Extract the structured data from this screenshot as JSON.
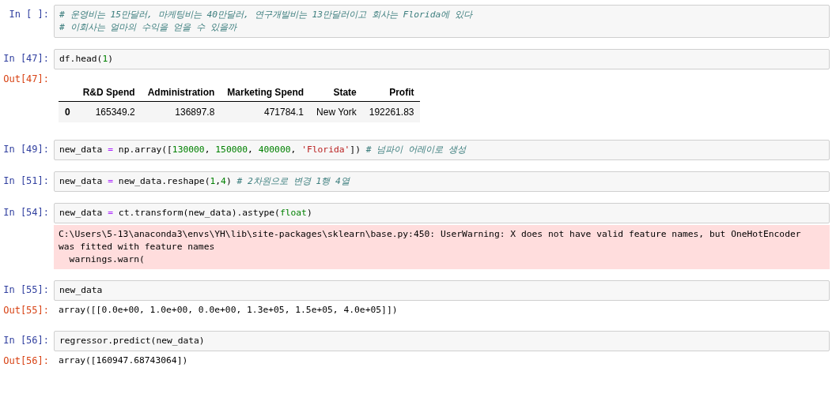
{
  "cells": [
    {
      "prompt": "In [ ]:",
      "lines": [
        [
          {
            "kind": "comment",
            "text": "# 운영비는 15만달러, 마케팅비는 40만달러, 연구개발비는 13만달러이고 회사는 Florida에 있다"
          }
        ],
        [
          {
            "kind": "comment",
            "text": "# 이회사는 얼마의 수익을 얻을 수 있을까"
          }
        ]
      ]
    },
    {
      "prompt": "In [47]:",
      "lines": [
        [
          {
            "kind": "plain",
            "text": "df.head("
          },
          {
            "kind": "num",
            "text": "1"
          },
          {
            "kind": "plain",
            "text": ")"
          }
        ]
      ],
      "output": {
        "kind": "table",
        "prompt": "Out[47]:",
        "columns": [
          "",
          "R&D Spend",
          "Administration",
          "Marketing Spend",
          "State",
          "Profit"
        ],
        "rows": [
          [
            "0",
            "165349.2",
            "136897.8",
            "471784.1",
            "New York",
            "192261.83"
          ]
        ]
      }
    },
    {
      "prompt": "In [49]:",
      "lines": [
        [
          {
            "kind": "plain",
            "text": "new_data "
          },
          {
            "kind": "op",
            "text": "="
          },
          {
            "kind": "plain",
            "text": " np.array(["
          },
          {
            "kind": "num",
            "text": "130000"
          },
          {
            "kind": "plain",
            "text": ", "
          },
          {
            "kind": "num",
            "text": "150000"
          },
          {
            "kind": "plain",
            "text": ", "
          },
          {
            "kind": "num",
            "text": "400000"
          },
          {
            "kind": "plain",
            "text": ", "
          },
          {
            "kind": "str",
            "text": "'Florida'"
          },
          {
            "kind": "plain",
            "text": "]) "
          },
          {
            "kind": "comment",
            "text": "# 넘파이 어레이로 생성"
          }
        ]
      ]
    },
    {
      "prompt": "In [51]:",
      "lines": [
        [
          {
            "kind": "plain",
            "text": "new_data "
          },
          {
            "kind": "op",
            "text": "="
          },
          {
            "kind": "plain",
            "text": " new_data.reshape("
          },
          {
            "kind": "num",
            "text": "1"
          },
          {
            "kind": "plain",
            "text": ","
          },
          {
            "kind": "num",
            "text": "4"
          },
          {
            "kind": "plain",
            "text": ") "
          },
          {
            "kind": "comment",
            "text": "# 2차원으로 변경 1행 4열"
          }
        ]
      ]
    },
    {
      "prompt": "In [54]:",
      "lines": [
        [
          {
            "kind": "plain",
            "text": "new_data "
          },
          {
            "kind": "op",
            "text": "="
          },
          {
            "kind": "plain",
            "text": " ct.transform(new_data).astype("
          },
          {
            "kind": "builtin",
            "text": "float"
          },
          {
            "kind": "plain",
            "text": ")"
          }
        ]
      ],
      "output": {
        "kind": "stderr",
        "lines": [
          "C:\\Users\\5-13\\anaconda3\\envs\\YH\\lib\\site-packages\\sklearn\\base.py:450: UserWarning: X does not have valid feature names, but OneHotEncoder",
          "was fitted with feature names",
          "  warnings.warn("
        ]
      }
    },
    {
      "prompt": "In [55]:",
      "lines": [
        [
          {
            "kind": "plain",
            "text": "new_data"
          }
        ]
      ],
      "output": {
        "kind": "text",
        "prompt": "Out[55]:",
        "lines": [
          "array([[0.0e+00, 1.0e+00, 0.0e+00, 1.3e+05, 1.5e+05, 4.0e+05]])"
        ]
      }
    },
    {
      "prompt": "In [56]:",
      "lines": [
        [
          {
            "kind": "plain",
            "text": "regressor.predict(new_data)"
          }
        ]
      ],
      "output": {
        "kind": "text",
        "prompt": "Out[56]:",
        "lines": [
          "array([160947.68743064])"
        ]
      }
    }
  ]
}
